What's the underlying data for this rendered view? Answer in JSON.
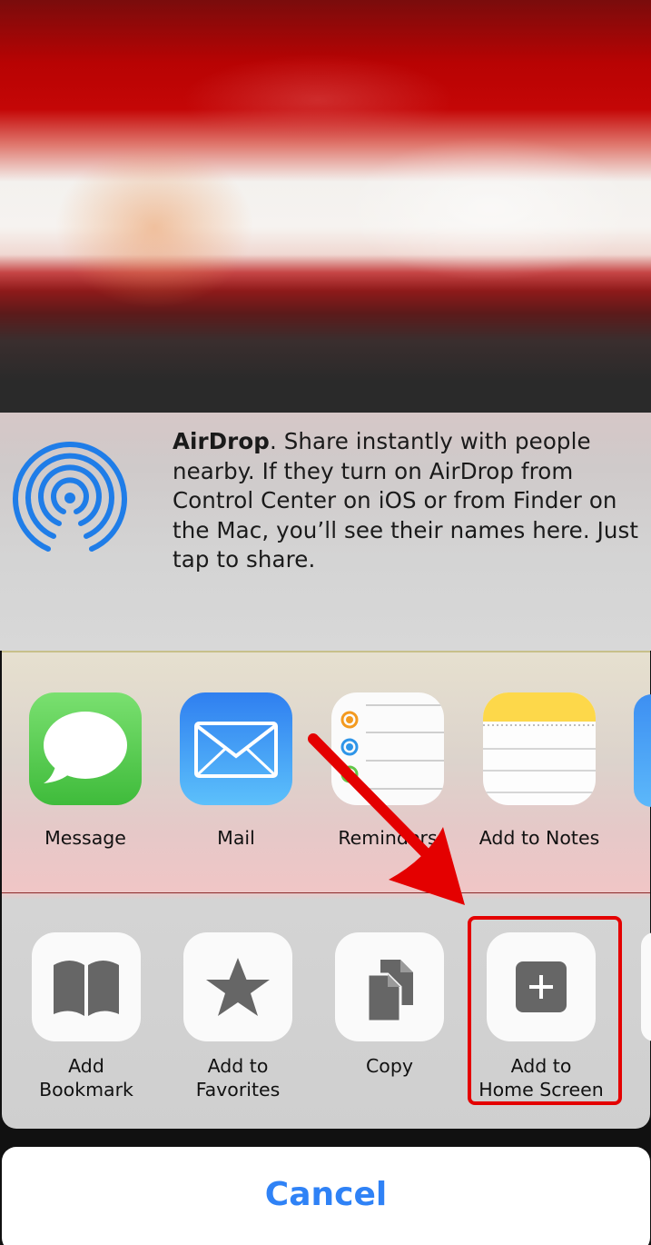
{
  "airdrop": {
    "title": "AirDrop",
    "message": ". Share instantly with people nearby. If they turn on AirDrop from Control Center on iOS or from Finder on the Mac, you’ll see their names here. Just tap to share."
  },
  "apps": [
    {
      "label": "Message",
      "icon": "message-icon"
    },
    {
      "label": "Mail",
      "icon": "mail-icon"
    },
    {
      "label": "Reminders",
      "icon": "reminders-icon"
    },
    {
      "label": "Add to Notes",
      "icon": "notes-icon"
    }
  ],
  "actions": [
    {
      "label_line1": "Add",
      "label_line2": "Bookmark",
      "icon": "book-icon"
    },
    {
      "label_line1": "Add to",
      "label_line2": "Favorites",
      "icon": "star-icon"
    },
    {
      "label_line1": "Copy",
      "label_line2": "",
      "icon": "copy-icon"
    },
    {
      "label_line1": "Add to",
      "label_line2": "Home Screen",
      "icon": "plus-square-icon"
    }
  ],
  "cancel": {
    "label": "Cancel"
  },
  "colors": {
    "accent": "#2f82f6",
    "highlight": "#e40000",
    "airdrop_blue": "#1f7de8"
  }
}
